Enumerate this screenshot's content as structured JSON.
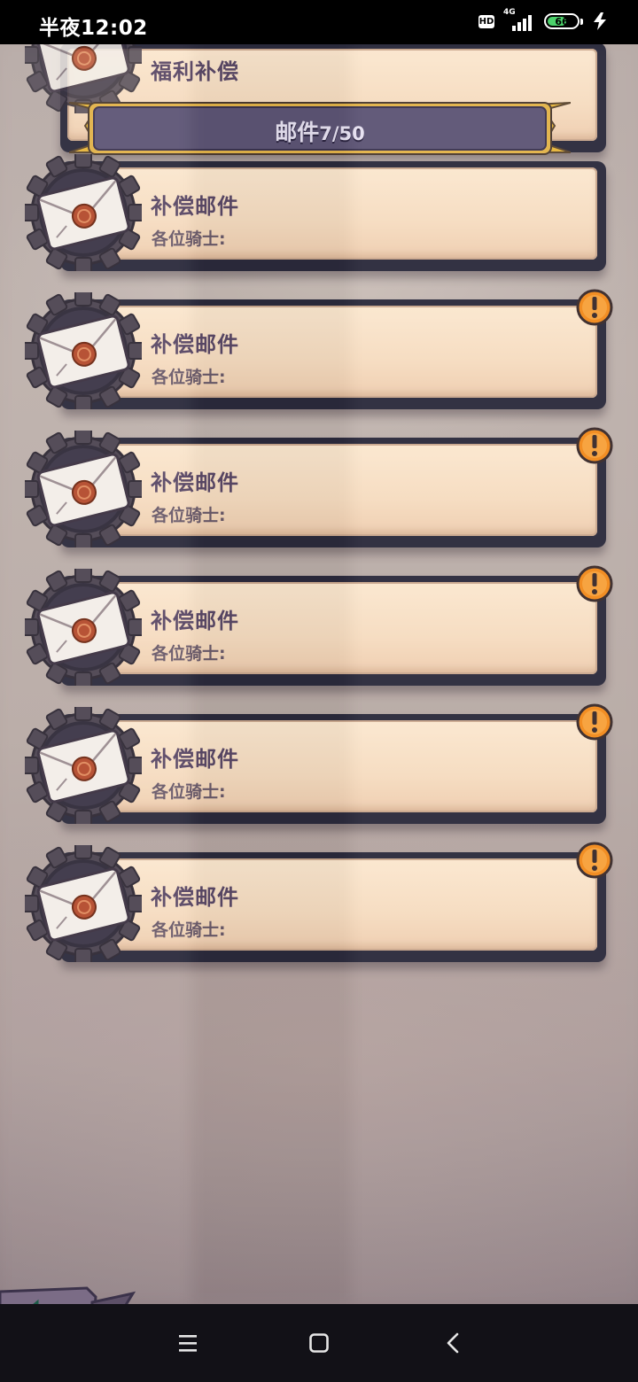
{
  "status_bar": {
    "time": "半夜12:02",
    "hd_label": "HD",
    "network": "4G",
    "battery": "66",
    "battery_level": 0.66,
    "battery_color": "#4cd26b"
  },
  "header": {
    "title": "邮件",
    "count": "7/50"
  },
  "top_card": {
    "title": "福利补偿"
  },
  "mails": [
    {
      "title": "补偿邮件",
      "greeting": "各位骑士:",
      "unread": false
    },
    {
      "title": "补偿邮件",
      "greeting": "各位骑士:",
      "unread": true
    },
    {
      "title": "补偿邮件",
      "greeting": "各位骑士:",
      "unread": true
    },
    {
      "title": "补偿邮件",
      "greeting": "各位骑士:",
      "unread": true
    },
    {
      "title": "补偿邮件",
      "greeting": "各位骑士:",
      "unread": true
    },
    {
      "title": "补偿邮件",
      "greeting": "各位骑士:",
      "unread": true
    }
  ],
  "colors": {
    "card_title": "#5a4866",
    "alert": "#f28a1c",
    "back_arrow": "#3dbb8a"
  },
  "icons": {
    "mail": "envelope-icon",
    "alert": "exclamation-icon",
    "back": "back-arrow-icon",
    "nav_menu": "menu-icon",
    "nav_home": "home-icon",
    "nav_back": "chevron-left-icon"
  }
}
